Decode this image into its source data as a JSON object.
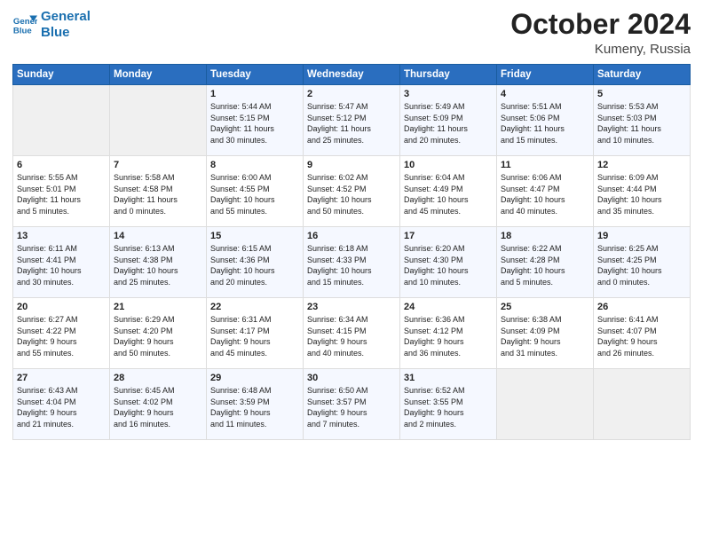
{
  "header": {
    "logo_line1": "General",
    "logo_line2": "Blue",
    "month": "October 2024",
    "location": "Kumeny, Russia"
  },
  "days_of_week": [
    "Sunday",
    "Monday",
    "Tuesday",
    "Wednesday",
    "Thursday",
    "Friday",
    "Saturday"
  ],
  "weeks": [
    [
      {
        "day": "",
        "info": ""
      },
      {
        "day": "",
        "info": ""
      },
      {
        "day": "1",
        "info": "Sunrise: 5:44 AM\nSunset: 5:15 PM\nDaylight: 11 hours\nand 30 minutes."
      },
      {
        "day": "2",
        "info": "Sunrise: 5:47 AM\nSunset: 5:12 PM\nDaylight: 11 hours\nand 25 minutes."
      },
      {
        "day": "3",
        "info": "Sunrise: 5:49 AM\nSunset: 5:09 PM\nDaylight: 11 hours\nand 20 minutes."
      },
      {
        "day": "4",
        "info": "Sunrise: 5:51 AM\nSunset: 5:06 PM\nDaylight: 11 hours\nand 15 minutes."
      },
      {
        "day": "5",
        "info": "Sunrise: 5:53 AM\nSunset: 5:03 PM\nDaylight: 11 hours\nand 10 minutes."
      }
    ],
    [
      {
        "day": "6",
        "info": "Sunrise: 5:55 AM\nSunset: 5:01 PM\nDaylight: 11 hours\nand 5 minutes."
      },
      {
        "day": "7",
        "info": "Sunrise: 5:58 AM\nSunset: 4:58 PM\nDaylight: 11 hours\nand 0 minutes."
      },
      {
        "day": "8",
        "info": "Sunrise: 6:00 AM\nSunset: 4:55 PM\nDaylight: 10 hours\nand 55 minutes."
      },
      {
        "day": "9",
        "info": "Sunrise: 6:02 AM\nSunset: 4:52 PM\nDaylight: 10 hours\nand 50 minutes."
      },
      {
        "day": "10",
        "info": "Sunrise: 6:04 AM\nSunset: 4:49 PM\nDaylight: 10 hours\nand 45 minutes."
      },
      {
        "day": "11",
        "info": "Sunrise: 6:06 AM\nSunset: 4:47 PM\nDaylight: 10 hours\nand 40 minutes."
      },
      {
        "day": "12",
        "info": "Sunrise: 6:09 AM\nSunset: 4:44 PM\nDaylight: 10 hours\nand 35 minutes."
      }
    ],
    [
      {
        "day": "13",
        "info": "Sunrise: 6:11 AM\nSunset: 4:41 PM\nDaylight: 10 hours\nand 30 minutes."
      },
      {
        "day": "14",
        "info": "Sunrise: 6:13 AM\nSunset: 4:38 PM\nDaylight: 10 hours\nand 25 minutes."
      },
      {
        "day": "15",
        "info": "Sunrise: 6:15 AM\nSunset: 4:36 PM\nDaylight: 10 hours\nand 20 minutes."
      },
      {
        "day": "16",
        "info": "Sunrise: 6:18 AM\nSunset: 4:33 PM\nDaylight: 10 hours\nand 15 minutes."
      },
      {
        "day": "17",
        "info": "Sunrise: 6:20 AM\nSunset: 4:30 PM\nDaylight: 10 hours\nand 10 minutes."
      },
      {
        "day": "18",
        "info": "Sunrise: 6:22 AM\nSunset: 4:28 PM\nDaylight: 10 hours\nand 5 minutes."
      },
      {
        "day": "19",
        "info": "Sunrise: 6:25 AM\nSunset: 4:25 PM\nDaylight: 10 hours\nand 0 minutes."
      }
    ],
    [
      {
        "day": "20",
        "info": "Sunrise: 6:27 AM\nSunset: 4:22 PM\nDaylight: 9 hours\nand 55 minutes."
      },
      {
        "day": "21",
        "info": "Sunrise: 6:29 AM\nSunset: 4:20 PM\nDaylight: 9 hours\nand 50 minutes."
      },
      {
        "day": "22",
        "info": "Sunrise: 6:31 AM\nSunset: 4:17 PM\nDaylight: 9 hours\nand 45 minutes."
      },
      {
        "day": "23",
        "info": "Sunrise: 6:34 AM\nSunset: 4:15 PM\nDaylight: 9 hours\nand 40 minutes."
      },
      {
        "day": "24",
        "info": "Sunrise: 6:36 AM\nSunset: 4:12 PM\nDaylight: 9 hours\nand 36 minutes."
      },
      {
        "day": "25",
        "info": "Sunrise: 6:38 AM\nSunset: 4:09 PM\nDaylight: 9 hours\nand 31 minutes."
      },
      {
        "day": "26",
        "info": "Sunrise: 6:41 AM\nSunset: 4:07 PM\nDaylight: 9 hours\nand 26 minutes."
      }
    ],
    [
      {
        "day": "27",
        "info": "Sunrise: 6:43 AM\nSunset: 4:04 PM\nDaylight: 9 hours\nand 21 minutes."
      },
      {
        "day": "28",
        "info": "Sunrise: 6:45 AM\nSunset: 4:02 PM\nDaylight: 9 hours\nand 16 minutes."
      },
      {
        "day": "29",
        "info": "Sunrise: 6:48 AM\nSunset: 3:59 PM\nDaylight: 9 hours\nand 11 minutes."
      },
      {
        "day": "30",
        "info": "Sunrise: 6:50 AM\nSunset: 3:57 PM\nDaylight: 9 hours\nand 7 minutes."
      },
      {
        "day": "31",
        "info": "Sunrise: 6:52 AM\nSunset: 3:55 PM\nDaylight: 9 hours\nand 2 minutes."
      },
      {
        "day": "",
        "info": ""
      },
      {
        "day": "",
        "info": ""
      }
    ]
  ]
}
